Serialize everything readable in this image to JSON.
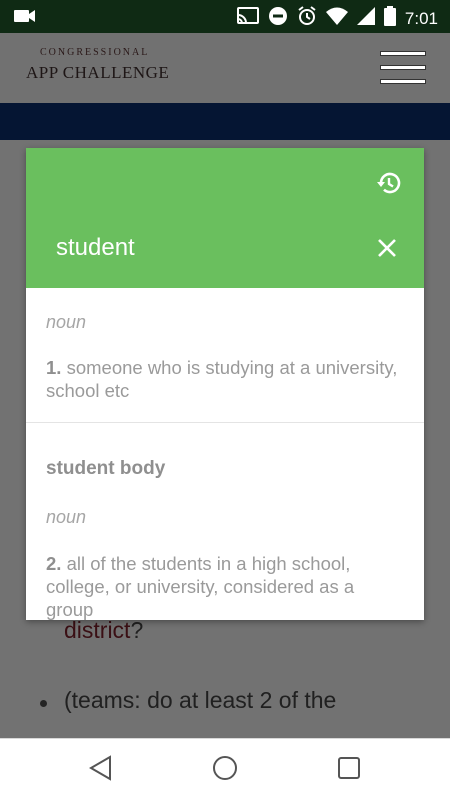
{
  "status_bar": {
    "time": "7:01",
    "icons": [
      "camera-icon",
      "cast-icon",
      "do-not-disturb-icon",
      "alarm-icon",
      "wifi-icon",
      "signal-icon",
      "battery-icon"
    ]
  },
  "background_page": {
    "logo": {
      "top": "CONGRESSIONAL",
      "bottom": "APP CHALLENGE"
    },
    "menu_icon": "hamburger-menu-icon",
    "visible_text": {
      "link": "district",
      "question_mark": "?",
      "bullet_text": "(teams: do at least 2 of the"
    }
  },
  "dictionary": {
    "word": "student",
    "history_icon": "history-icon",
    "close_icon": "close-icon",
    "entries": [
      {
        "part_of_speech": "noun",
        "number": "1.",
        "definition": "someone who is studying at a university, school etc"
      },
      {
        "phrase": "student body",
        "part_of_speech": "noun",
        "number": "2.",
        "definition": "all of the students in a high school, college, or university, considered as a group"
      }
    ],
    "colors": {
      "header": "#6abf5e"
    }
  },
  "nav_bar": {
    "icons": [
      "back-icon",
      "home-icon",
      "recents-icon"
    ]
  }
}
